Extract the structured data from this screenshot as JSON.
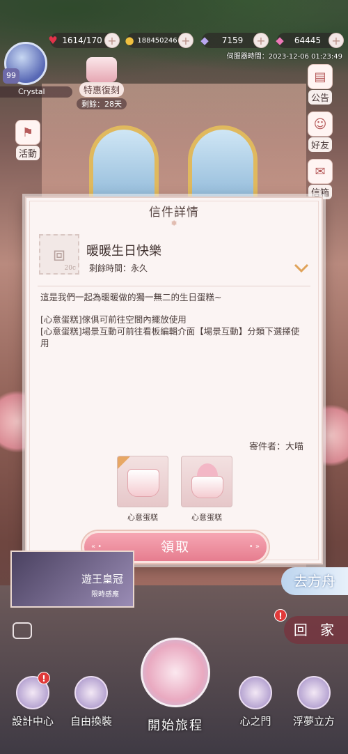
{
  "topbar": {
    "stamina": "1614/170",
    "coins": "188450246",
    "crystals": "7159",
    "diamonds": "64445",
    "server_time": "伺服器時間：2023-12-06 01:23:49"
  },
  "player": {
    "level": "99",
    "name": "Crystal"
  },
  "promo": {
    "label": "特惠復刻",
    "remaining": "剩餘：28天"
  },
  "left_menu": {
    "activity": "活動"
  },
  "right_menu": {
    "announcement": "公告",
    "friends": "好友",
    "mailbox": "信箱"
  },
  "dialog": {
    "title": "信件詳情",
    "mail_title": "暖暖生日快樂",
    "remaining": "剩餘時間：永久",
    "stamp_value": "20c",
    "message": "這是我們一起為暖暖做的獨一無二的生日蛋糕~",
    "note1": "[心意蛋糕]傢俱可前往空間內擺放使用",
    "note2": "[心意蛋糕]場景互動可前往看板編輯介面【場景互動】分類下選擇使用",
    "sender": "寄件者：大喵",
    "attachments": [
      {
        "label": "心意蛋糕"
      },
      {
        "label": "心意蛋糕"
      }
    ],
    "claim_label": "領取"
  },
  "banner": {
    "title": "遊王皇冠",
    "subtitle": "限時感應"
  },
  "right_bottom": {
    "boat": "去方舟",
    "home": "回 家"
  },
  "bottom_nav": {
    "design": "設計中心",
    "wardrobe": "自由換裝",
    "start": "開始旅程",
    "heart_gate": "心之門",
    "cube": "浮夢立方"
  },
  "colors": {
    "accent": "#e67d8f",
    "dialog_bg": "#fbf4f3"
  }
}
